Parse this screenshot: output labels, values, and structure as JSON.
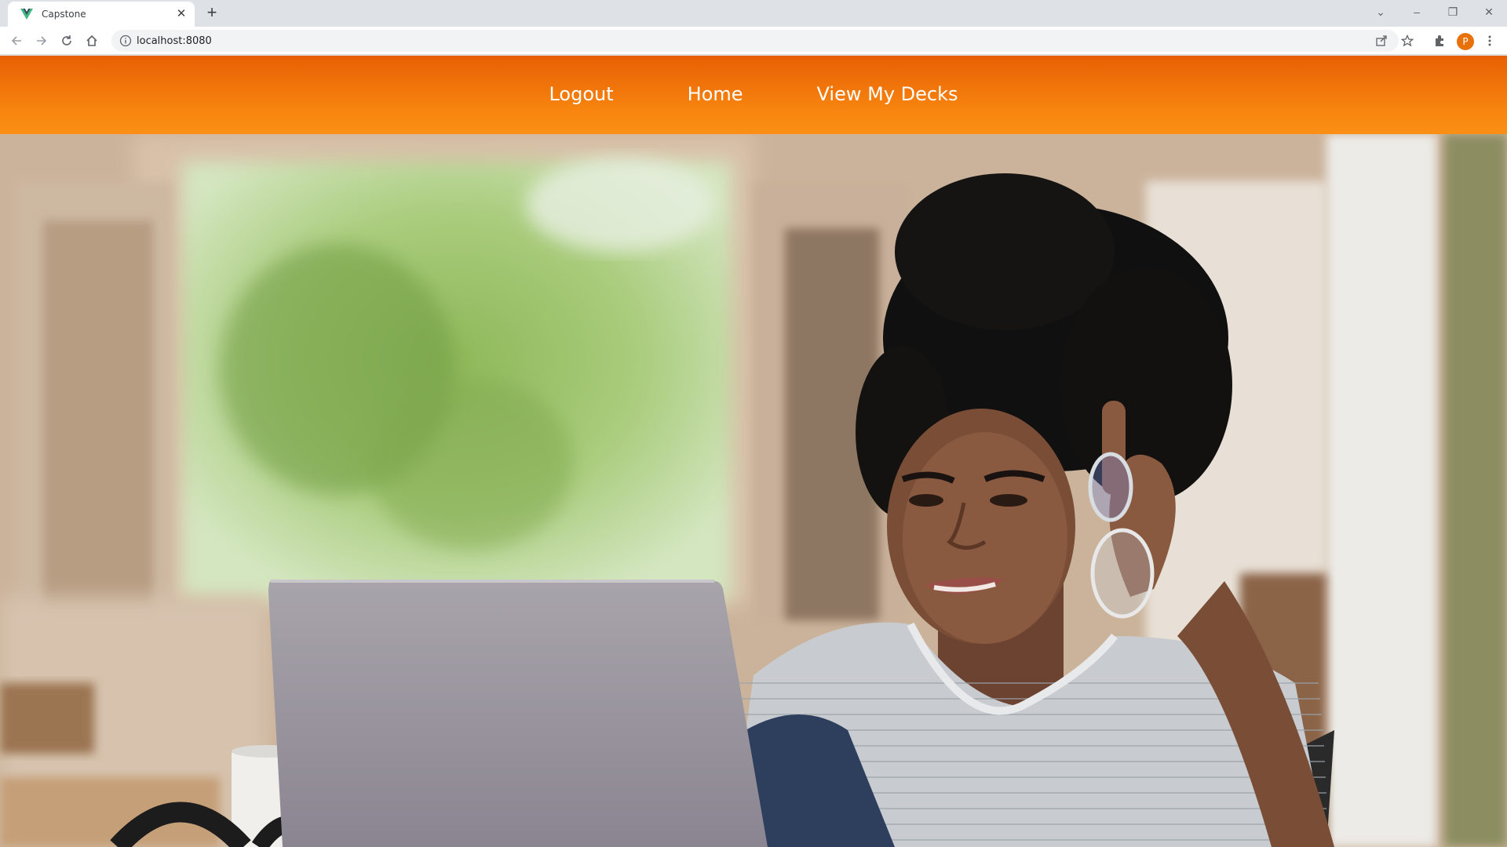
{
  "browser": {
    "tab_title": "Capstone",
    "url": "localhost:8080",
    "profile_initial": "P"
  },
  "nav": {
    "items": [
      {
        "label": "Logout"
      },
      {
        "label": "Home"
      },
      {
        "label": "View My Decks"
      }
    ]
  },
  "colors": {
    "nav_top": "#e85f04",
    "nav_bottom": "#fb8f14",
    "nav_text": "#ffffff"
  },
  "hero": {
    "icon": "photo-woman-laptop"
  }
}
